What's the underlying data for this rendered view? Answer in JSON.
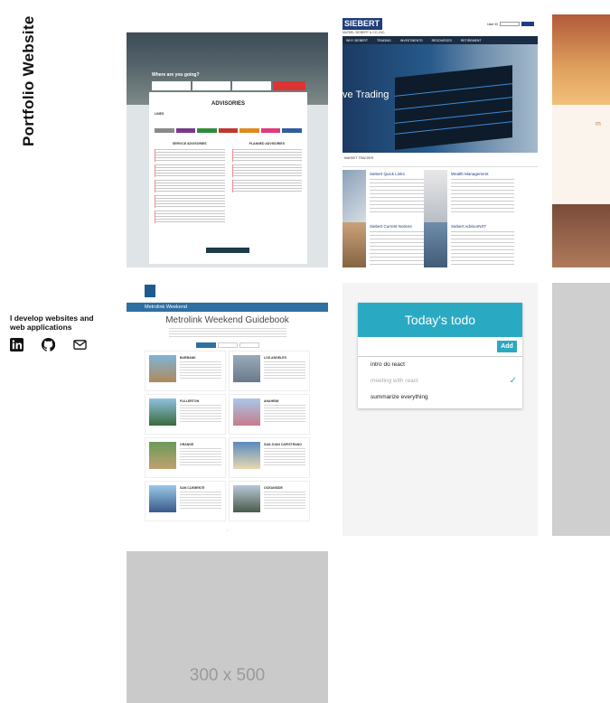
{
  "site": {
    "title": "Portfolio Website",
    "tagline": "I develop websites and web applications"
  },
  "social": [
    {
      "icon": "linkedin-icon",
      "label": "LinkedIn"
    },
    {
      "icon": "github-icon",
      "label": "GitHub"
    },
    {
      "icon": "email-icon",
      "label": "Email"
    }
  ],
  "projects": {
    "travel": {
      "question": "Where are you going?",
      "heading": "ADVISORIES",
      "lines_label": "LINES",
      "service_advisories": "SERVICE ADVISORIES",
      "planned_advisories": "PLANNED ADVISORIES",
      "line_colors": [
        "#8a8a8a",
        "#7a3a8a",
        "#2e8b3e",
        "#c0392b",
        "#e08a1e",
        "#e03a7a",
        "#2f5fa0"
      ]
    },
    "finance": {
      "logo": "SIEBERT",
      "logo_sub": "MURIEL SIEBERT & CO.,INC.",
      "user_id": "User ID",
      "nav": [
        "WHY SIEBERT",
        "TRADING",
        "INVESTMENTS",
        "RESOURCES",
        "RETIREMENT"
      ],
      "hero": "ve Trading",
      "ticker": "MARKET TRACKER",
      "cards": [
        "Siebert Quick Links",
        "Wealth Management",
        "Siebert Current Notices",
        "Siebert AdvisorNXT"
      ]
    },
    "guidebook": {
      "brand": "Metrolink Weekend",
      "heading": "Metrolink Weekend Guidebook",
      "cities": [
        "BURBANK",
        "LOS ANGELES",
        "FULLERTON",
        "ANAHEIM",
        "ORANGE",
        "SAN JUAN CAPISTRANO",
        "SAN CLEMENTE",
        "OCEANSIDE"
      ]
    },
    "todo": {
      "title": "Today's todo",
      "add": "Add",
      "items": [
        {
          "text": "intro do react",
          "done": false
        },
        {
          "text": "meeting with react",
          "done": true
        },
        {
          "text": "summarize everything",
          "done": false
        }
      ]
    },
    "placeholder": "300 x 500"
  }
}
